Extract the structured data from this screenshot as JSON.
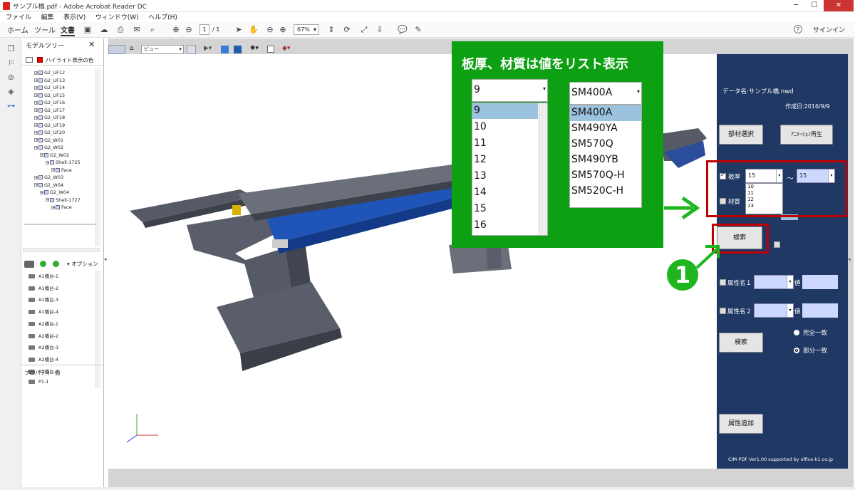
{
  "window": {
    "title": "サンプル橋.pdf - Adobe Acrobat Reader DC",
    "min": "─",
    "max": "☐",
    "close": "✕"
  },
  "menu": [
    "ファイル",
    "編集",
    "表示(V)",
    "ウィンドウ(W)",
    "ヘルプ(H)"
  ],
  "toolbar": {
    "tabs": [
      "ホーム",
      "ツール",
      "文書"
    ],
    "page_current": "1",
    "page_total": "/ 1",
    "zoom": "67%",
    "help": "?",
    "signin": "サインイン"
  },
  "panel": {
    "title": "モデルツリー",
    "close": "✕",
    "highlight_label": "ハイライト表示の色",
    "tree": [
      "G2_UF12",
      "G2_UF13",
      "G2_UF14",
      "G2_UF15",
      "G2_UF16",
      "G2_UF17",
      "G2_UF18",
      "G2_UF19",
      "G2_UF20",
      "G2_W01",
      "G2_W02",
      "G2_W02",
      "Shell-1725",
      "Face",
      "G2_W03",
      "G2_W04",
      "G2_W04",
      "Shell-1727",
      "Face"
    ],
    "options_label": "オプション",
    "parts": [
      "A1橋台-1",
      "A1橋台-2",
      "A1橋台-3",
      "A1橋台-4",
      "A2橋台-1",
      "A2橋台-2",
      "A2橋台-3",
      "A2橋台-4",
      "A2橋台-5",
      "P1-1"
    ],
    "footer_prop": "プロパティ",
    "footer_val": "値"
  },
  "viewport": {
    "view_label": "ビュー"
  },
  "callout": {
    "title": "板厚、材質は値をリスト表示",
    "thickness_selected": "9",
    "thickness_items": [
      "9",
      "10",
      "11",
      "12",
      "13",
      "14",
      "15",
      "16"
    ],
    "material_selected": "SM400A",
    "material_items": [
      "SM400A",
      "SM490YA",
      "SM570Q",
      "SM490YB",
      "SM570Q-H",
      "SM520C-H"
    ]
  },
  "form": {
    "data_name": "データ名:サンプル橋.nwd",
    "created": "作成日:2016/9/9",
    "btn_member": "部材選択",
    "btn_anim": "ｱﾆﾒｰｼｮﾝ再生",
    "thickness_label": "板厚",
    "thickness_from": "15",
    "thickness_to": "15",
    "tilde": "～",
    "thickness_dropdown": [
      "10",
      "11",
      "12",
      "13"
    ],
    "material_label": "材質",
    "search1": "検索",
    "attr1": "属性名１",
    "attr2": "属性名２",
    "val": "値",
    "search2": "検索",
    "exact": "完全一致",
    "partial": "部分一致",
    "add_attr": "属性追加",
    "footer": "CIM-PDF Ver1.00 supported by office-k1.co.jp"
  },
  "badge": "1",
  "colors": {
    "form_bg": "#1f3864",
    "callout_bg": "#0ca012",
    "highlight": "#c00000",
    "select_bg": "#ccd8ff"
  }
}
